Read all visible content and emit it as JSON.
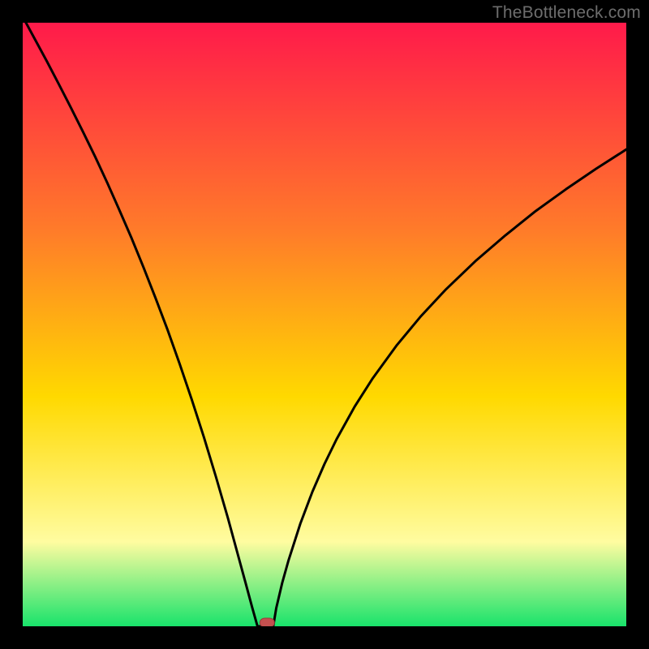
{
  "watermark": "TheBottleneck.com",
  "colors": {
    "bg_black": "#000000",
    "grad_top": "#ff1a4a",
    "grad_mid1": "#ff7a2a",
    "grad_mid2": "#ffd900",
    "grad_mid3": "#fffca0",
    "grad_bottom": "#19e36b",
    "curve": "#000000",
    "marker_fill": "#c4504f",
    "marker_stroke": "#9c3a3a"
  },
  "chart_data": {
    "type": "line",
    "title": "",
    "xlabel": "",
    "ylabel": "",
    "xlim": [
      0,
      100
    ],
    "ylim": [
      0,
      100
    ],
    "notch_x": 40.2,
    "notch_half_width": 1.3,
    "series": [
      {
        "name": "curve",
        "x": [
          0,
          2,
          4,
          6,
          8,
          10,
          12,
          14,
          16,
          18,
          20,
          22,
          24,
          26,
          28,
          30,
          32,
          34,
          36,
          37,
          38,
          38.9,
          41.5,
          42,
          43,
          44,
          46,
          48,
          50,
          52,
          55,
          58,
          62,
          66,
          70,
          75,
          80,
          85,
          90,
          95,
          100
        ],
        "y": [
          101,
          97.3,
          93.6,
          89.8,
          85.9,
          81.9,
          77.8,
          73.5,
          69.0,
          64.4,
          59.5,
          54.4,
          49.1,
          43.5,
          37.6,
          31.4,
          24.8,
          17.9,
          10.6,
          6.9,
          3.2,
          0.0,
          0.0,
          3.0,
          7.2,
          10.8,
          17.0,
          22.3,
          26.9,
          31.0,
          36.4,
          41.1,
          46.6,
          51.4,
          55.7,
          60.5,
          64.8,
          68.8,
          72.4,
          75.8,
          79.0
        ]
      }
    ],
    "marker": {
      "x": 40.5,
      "y": 0.6
    }
  }
}
